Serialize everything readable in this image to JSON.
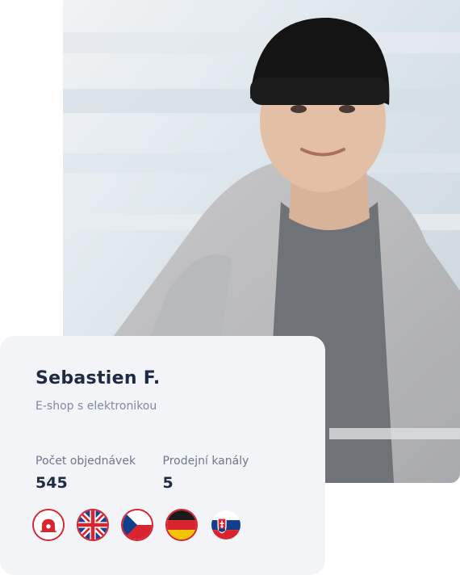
{
  "profile": {
    "name": "Sebastien F.",
    "subtitle": "E-shop s elektronikou"
  },
  "stats": [
    {
      "label": "Počet objednávek",
      "value": "545"
    },
    {
      "label": "Prodejní kanály",
      "value": "5"
    }
  ],
  "channels": [
    {
      "icon": "store-icon"
    },
    {
      "icon": "uk-flag-icon"
    },
    {
      "icon": "cz-flag-icon"
    },
    {
      "icon": "de-flag-icon"
    },
    {
      "icon": "sk-flag-icon"
    }
  ],
  "colors": {
    "card_bg": "#f3f4f7",
    "name": "#1f2a44",
    "accent_red": "#d7242f"
  }
}
